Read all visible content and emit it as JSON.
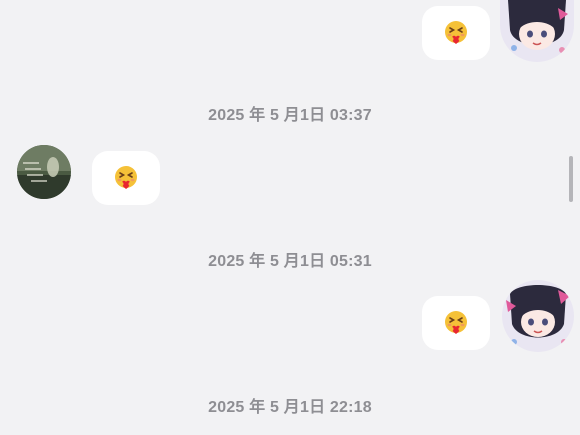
{
  "messages": [
    {
      "type": "emoji",
      "side": "right",
      "content": "heart-hug-emoji"
    },
    {
      "type": "timestamp",
      "text": "2025 年 5 月1日 03:37"
    },
    {
      "type": "emoji",
      "side": "left",
      "content": "heart-hug-emoji"
    },
    {
      "type": "timestamp",
      "text": "2025 年 5 月1日 05:31"
    },
    {
      "type": "emoji",
      "side": "right",
      "content": "heart-hug-emoji"
    },
    {
      "type": "timestamp",
      "text": "2025 年 5 月1日 22:18"
    }
  ],
  "colors": {
    "background": "#f2f2f4",
    "bubble": "#ffffff",
    "timestamp": "#8e8e93",
    "emoji_face": "#f5c138",
    "heart": "#e8262f"
  }
}
